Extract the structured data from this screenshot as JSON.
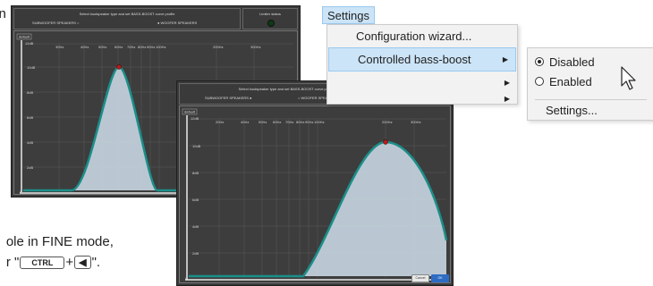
{
  "doc": {
    "fragment_top": "n",
    "fragment_line1": "ole in FINE mode,",
    "fragment_line2_prefix": "r \"",
    "key_ctrl": "CTRL",
    "key_plus": "+",
    "key_arrow": "◀",
    "fragment_line2_suffix": "\"."
  },
  "back_window": {
    "header": "Select loudspeaker type and set BASS-BOOST curve profile",
    "opt1_label": "SUBWOOFER SPEAKERS",
    "opt2_label": "WOOFER SPEAKERS",
    "limiter_label": "Limiter status",
    "preset_label": "default",
    "freq_ticks": [
      "30Hz",
      "40Hz",
      "50Hz",
      "60Hz",
      "70Hz",
      "80Hz",
      "90Hz",
      "100Hz",
      "200Hz",
      "300Hz"
    ],
    "db_ticks": [
      "12dB",
      "10dB",
      "8dB",
      "6dB",
      "4dB",
      "2dB",
      "0"
    ]
  },
  "front_window": {
    "header": "Select loudspeaker type and set BASS-BOOST curve profile",
    "opt1_label": "SUBWOOFER SPEAKERS",
    "opt2_label": "WOOFER SPEAKERS",
    "limiter_label": "Limiter status",
    "preset_label": "default",
    "freq_ticks": [
      "20Hz",
      "40Hz",
      "50Hz",
      "60Hz",
      "70Hz",
      "80Hz",
      "90Hz",
      "100Hz",
      "200Hz",
      "300Hz"
    ],
    "db_ticks": [
      "12dB",
      "10dB",
      "8dB",
      "6dB",
      "4dB",
      "2dB",
      "0"
    ],
    "cancel_label": "Cancel",
    "ok_label": "OK"
  },
  "menu": {
    "settings_label": "Settings",
    "items": [
      "Configuration wizard...",
      "Controlled bass-boost"
    ],
    "submenu": {
      "disabled_label": "Disabled",
      "enabled_label": "Enabled",
      "settings_label": "Settings..."
    }
  },
  "colors": {
    "curve_stroke": "#1b8f8a",
    "curve_fill": "#c8d6e2",
    "peak_marker": "#c01818",
    "window_bg": "#3a3a3a",
    "menu_highlight": "#cce4f7"
  }
}
